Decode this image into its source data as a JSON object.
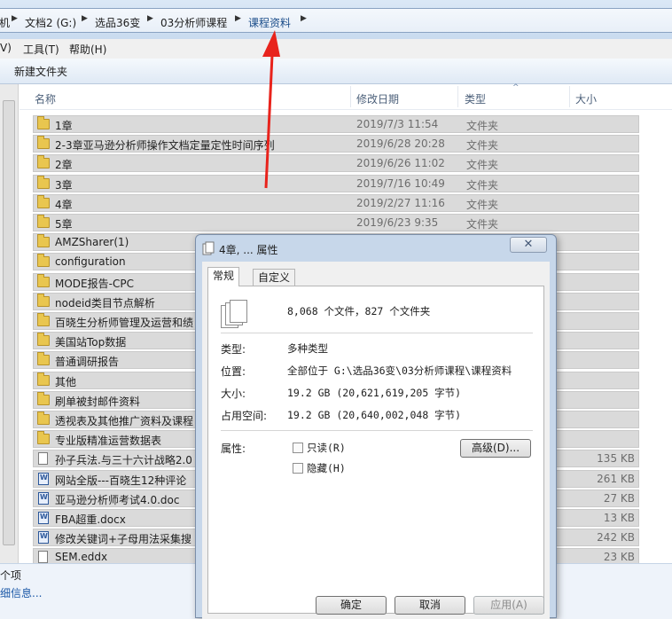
{
  "address": {
    "crumbs": [
      "机",
      "文档2 (G:)",
      "选品36变",
      "03分析师课程",
      "课程资料"
    ]
  },
  "menu": {
    "items": [
      "V)",
      "工具(T)",
      "帮助(H)"
    ]
  },
  "toolbar": {
    "new_folder": "新建文件夹"
  },
  "columns": {
    "name": "名称",
    "modified": "修改日期",
    "type": "类型",
    "size": "大小"
  },
  "files": [
    {
      "name": "1章",
      "date": "2019/7/3 11:54",
      "type": "文件夹",
      "size": "",
      "icon": "folder-icon"
    },
    {
      "name": "2-3章亚马逊分析师操作文档定量定性时间序列",
      "date": "2019/6/28 20:28",
      "type": "文件夹",
      "size": "",
      "icon": "folder-icon"
    },
    {
      "name": "2章",
      "date": "2019/6/26 11:02",
      "type": "文件夹",
      "size": "",
      "icon": "folder-icon"
    },
    {
      "name": "3章",
      "date": "2019/7/16 10:49",
      "type": "文件夹",
      "size": "",
      "icon": "folder-icon"
    },
    {
      "name": "4章",
      "date": "2019/2/27 11:16",
      "type": "文件夹",
      "size": "",
      "icon": "folder-icon"
    },
    {
      "name": "5章",
      "date": "2019/6/23 9:35",
      "type": "文件夹",
      "size": "",
      "icon": "folder-icon"
    },
    {
      "name": "AMZSharer(1)",
      "date": "",
      "type": "",
      "size": "",
      "icon": "folder-icon"
    },
    {
      "name": "configuration",
      "date": "",
      "type": "",
      "size": "",
      "icon": "folder-icon"
    },
    {
      "name": "MODE报告-CPC",
      "date": "",
      "type": "",
      "size": "",
      "icon": "folder-icon"
    },
    {
      "name": "nodeid类目节点解析",
      "date": "",
      "type": "",
      "size": "",
      "icon": "folder-icon"
    },
    {
      "name": "百晓生分析师管理及运营和绩",
      "date": "",
      "type": "",
      "size": "",
      "icon": "folder-icon"
    },
    {
      "name": "美国站Top数据",
      "date": "",
      "type": "",
      "size": "",
      "icon": "folder-icon"
    },
    {
      "name": "普通调研报告",
      "date": "",
      "type": "",
      "size": "",
      "icon": "folder-icon"
    },
    {
      "name": "其他",
      "date": "",
      "type": "",
      "size": "",
      "icon": "folder-icon"
    },
    {
      "name": "刷单被封邮件资料",
      "date": "",
      "type": "",
      "size": "",
      "icon": "folder-icon"
    },
    {
      "name": "透视表及其他推广资料及课程",
      "date": "",
      "type": "",
      "size": "",
      "icon": "folder-icon"
    },
    {
      "name": "专业版精准运营数据表",
      "date": "",
      "type": "",
      "size": "",
      "icon": "folder-icon"
    },
    {
      "name": "孙子兵法.与三十六计战略2.0",
      "date": "",
      "type": "",
      "size": "135 KB",
      "icon": "text-file-icon"
    },
    {
      "name": "网站全版---百晓生12种评论",
      "date": "",
      "type": "",
      "size": "261 KB",
      "icon": "word-doc-icon"
    },
    {
      "name": "亚马逊分析师考试4.0.doc",
      "date": "",
      "type": "",
      "size": "27 KB",
      "icon": "word-doc-icon"
    },
    {
      "name": "FBA超重.docx",
      "date": "",
      "type": "",
      "size": "13 KB",
      "icon": "word-doc-icon"
    },
    {
      "name": "修改关键词+子母用法采集搜",
      "date": "",
      "type": "",
      "size": "242 KB",
      "icon": "word-doc-icon"
    },
    {
      "name": "SEM.eddx",
      "date": "",
      "type": "",
      "size": "23 KB",
      "icon": "text-file-icon"
    }
  ],
  "status": {
    "count": "个项",
    "details": "细信息..."
  },
  "dialog": {
    "title": "4章, ... 属性",
    "close": "✕",
    "tabs": [
      "常规",
      "自定义"
    ],
    "summary": "8,068 个文件，827 个文件夹",
    "rows": [
      {
        "label": "类型:",
        "value": "多种类型"
      },
      {
        "label": "位置:",
        "value": "全部位于 G:\\选品36变\\03分析师课程\\课程资料"
      },
      {
        "label": "大小:",
        "value": "19.2 GB (20,621,619,205 字节)"
      },
      {
        "label": "占用空间:",
        "value": "19.2 GB (20,640,002,048 字节)"
      }
    ],
    "attributes_label": "属性:",
    "readonly_label": "只读(R)",
    "hidden_label": "隐藏(H)",
    "advanced_button": "高级(D)...",
    "ok_button": "确定",
    "cancel_button": "取消",
    "apply_button": "应用(A)"
  }
}
